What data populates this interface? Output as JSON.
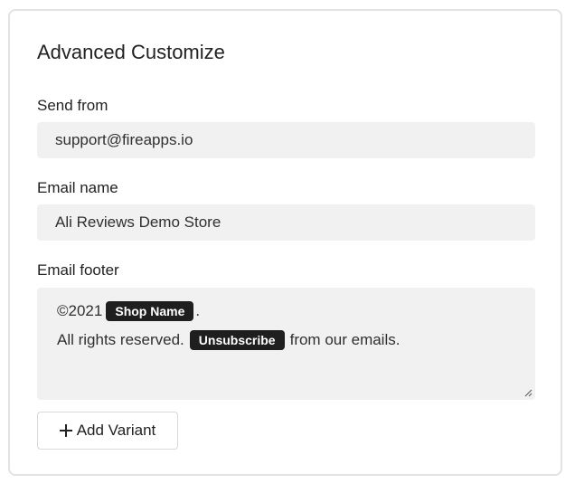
{
  "card": {
    "title": "Advanced Customize"
  },
  "fields": {
    "send_from": {
      "label": "Send from",
      "value": "support@fireapps.io"
    },
    "email_name": {
      "label": "Email name",
      "value": "Ali Reviews Demo Store"
    },
    "email_footer": {
      "label": "Email footer",
      "line1_prefix": "©2021",
      "shop_name_tag": "Shop Name",
      "line1_suffix": ".",
      "line2_prefix": "All rights reserved.",
      "unsubscribe_tag": "Unsubscribe",
      "line2_suffix": "from our emails."
    }
  },
  "actions": {
    "add_variant_label": "Add Variant"
  },
  "colors": {
    "field_background": "#f1f1f1",
    "tag_background": "#1f1f1f",
    "card_border": "#e1e3e5"
  }
}
